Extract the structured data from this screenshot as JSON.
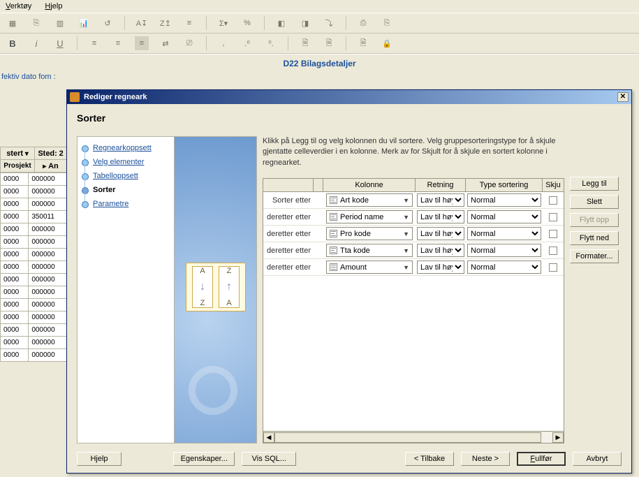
{
  "menubar": {
    "tools": "Verktøy",
    "help": "Hjelp"
  },
  "doc_title": "D22 Bilagsdetaljer",
  "frag_left": "fektiv dato fom :",
  "filters": {
    "stert_label": "stert",
    "sted_label": "Sted:",
    "sted_value": "2",
    "prosjekt_label": "Prosjekt",
    "an_label": "An"
  },
  "bg_rows": [
    "0000",
    "0000",
    "0000",
    "0000",
    "0000",
    "0000",
    "0000",
    "0000",
    "0000",
    "0000",
    "0000",
    "0000",
    "0000",
    "0000",
    "0000"
  ],
  "bg_col2": [
    "000000",
    "000000",
    "000000",
    "350011",
    "000000",
    "000000",
    "000000",
    "000000",
    "000000",
    "000000",
    "000000",
    "000000",
    "000000",
    "000000",
    "000000"
  ],
  "dialog": {
    "title": "Rediger regneark",
    "heading": "Sorter",
    "instruction": "Klikk på Legg til og velg kolonnen du vil sortere. Velg gruppesorteringstype for å skjule gjentatte celleverdier i en kolonne. Merk av for Skjult for å skjule en sortert kolonne i regnearket.",
    "steps": [
      {
        "label": "Regnearkoppsett",
        "active": false
      },
      {
        "label": "Velg elementer",
        "active": false
      },
      {
        "label": "Tabelloppsett",
        "active": false
      },
      {
        "label": "Sorter",
        "active": true
      },
      {
        "label": "Parametre",
        "active": false
      }
    ],
    "headers": {
      "kolonne": "Kolonne",
      "retning": "Retning",
      "type": "Type sortering",
      "skjult": "Skju"
    },
    "row_label_first": "Sorter etter",
    "row_label_rest": "deretter etter",
    "rows": [
      {
        "kol": "Art kode",
        "ico": "hier",
        "ret": "Lav til høy",
        "typ": "Normal"
      },
      {
        "kol": "Period name",
        "ico": "hier",
        "ret": "Lav til høy",
        "typ": "Normal"
      },
      {
        "kol": "Pro kode",
        "ico": "hier",
        "ret": "Lav til høy",
        "typ": "Normal"
      },
      {
        "kol": "Tta kode",
        "ico": "hier",
        "ret": "Lav til høy",
        "typ": "Normal"
      },
      {
        "kol": "Amount",
        "ico": "num",
        "ret": "Lav til høy",
        "typ": "Normal"
      }
    ],
    "buttons": {
      "add": "Legg til",
      "delete": "Slett",
      "moveup": "Flytt opp",
      "movedown": "Flytt ned",
      "format": "Formater...",
      "help": "Hjelp",
      "props": "Egenskaper...",
      "sql": "Vis SQL...",
      "back": "< Tilbake",
      "next": "Neste >",
      "finish": "Fullfør",
      "cancel": "Avbryt"
    }
  }
}
